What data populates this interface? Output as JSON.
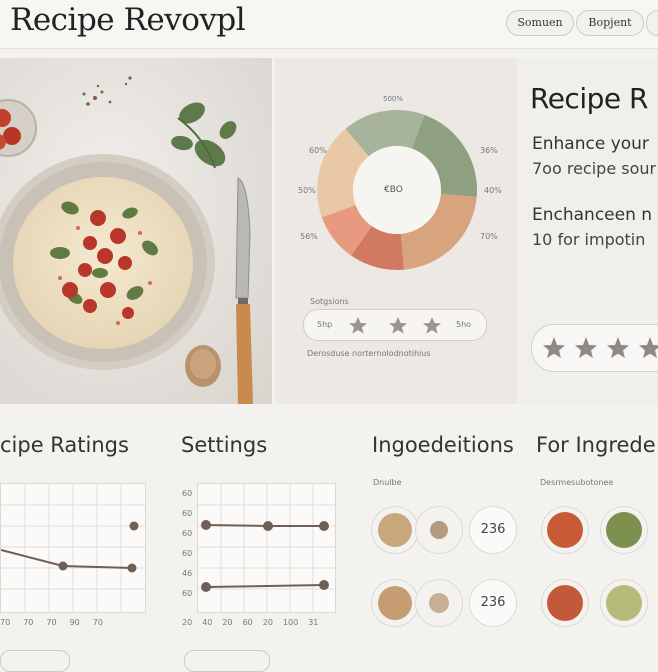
{
  "header": {
    "title": "Recipe Revovpl",
    "buttons": [
      "Somuen",
      "Bopjent"
    ]
  },
  "donut": {
    "top_label": "500%",
    "left_labels": [
      "60%",
      "50%",
      "56%"
    ],
    "right_labels": [
      "36%",
      "40%",
      "70%"
    ],
    "center_label": "€BO",
    "segments_color": [
      "#e9c9a5",
      "#a7b39a",
      "#8fa081",
      "#d8a47e",
      "#d27a61",
      "#e79a80"
    ]
  },
  "rating_widget": {
    "label": "Sotgsions",
    "left_value": "5hp",
    "right_value": "5ho",
    "caption": "Derosduse norternolodnotihius"
  },
  "right_panel": {
    "heading": "Recipe R",
    "line1a": "Enhance your",
    "line1b": "7oo recipe sour",
    "line2a": "Enchanceen n",
    "line2b": "10 for impotin",
    "stars_count": 5
  },
  "sections": {
    "ratings_title": "cipe Ratings",
    "settings_title": "Settings",
    "ingredients_title": "Ingoedeitions",
    "for_ingredients_title": "For Ingrede",
    "ingredients_sub": "Dnulbe",
    "for_ingredients_sub": "Desrmesubotonee"
  },
  "settings_chart": {
    "y_ticks": [
      "60",
      "60",
      "60",
      "60",
      "46",
      "60",
      "60"
    ],
    "x_ticks": [
      "20",
      "40",
      "20",
      "60",
      "20",
      "100",
      "31"
    ]
  },
  "ratings_chart": {
    "x_ticks": [
      "70",
      "70",
      "70",
      "90",
      "70"
    ]
  },
  "ingredient_badges": [
    "236",
    "236"
  ],
  "colors": {
    "accent": "#8a6a55",
    "panel": "#ece9e4",
    "line": "#6f5f55"
  }
}
